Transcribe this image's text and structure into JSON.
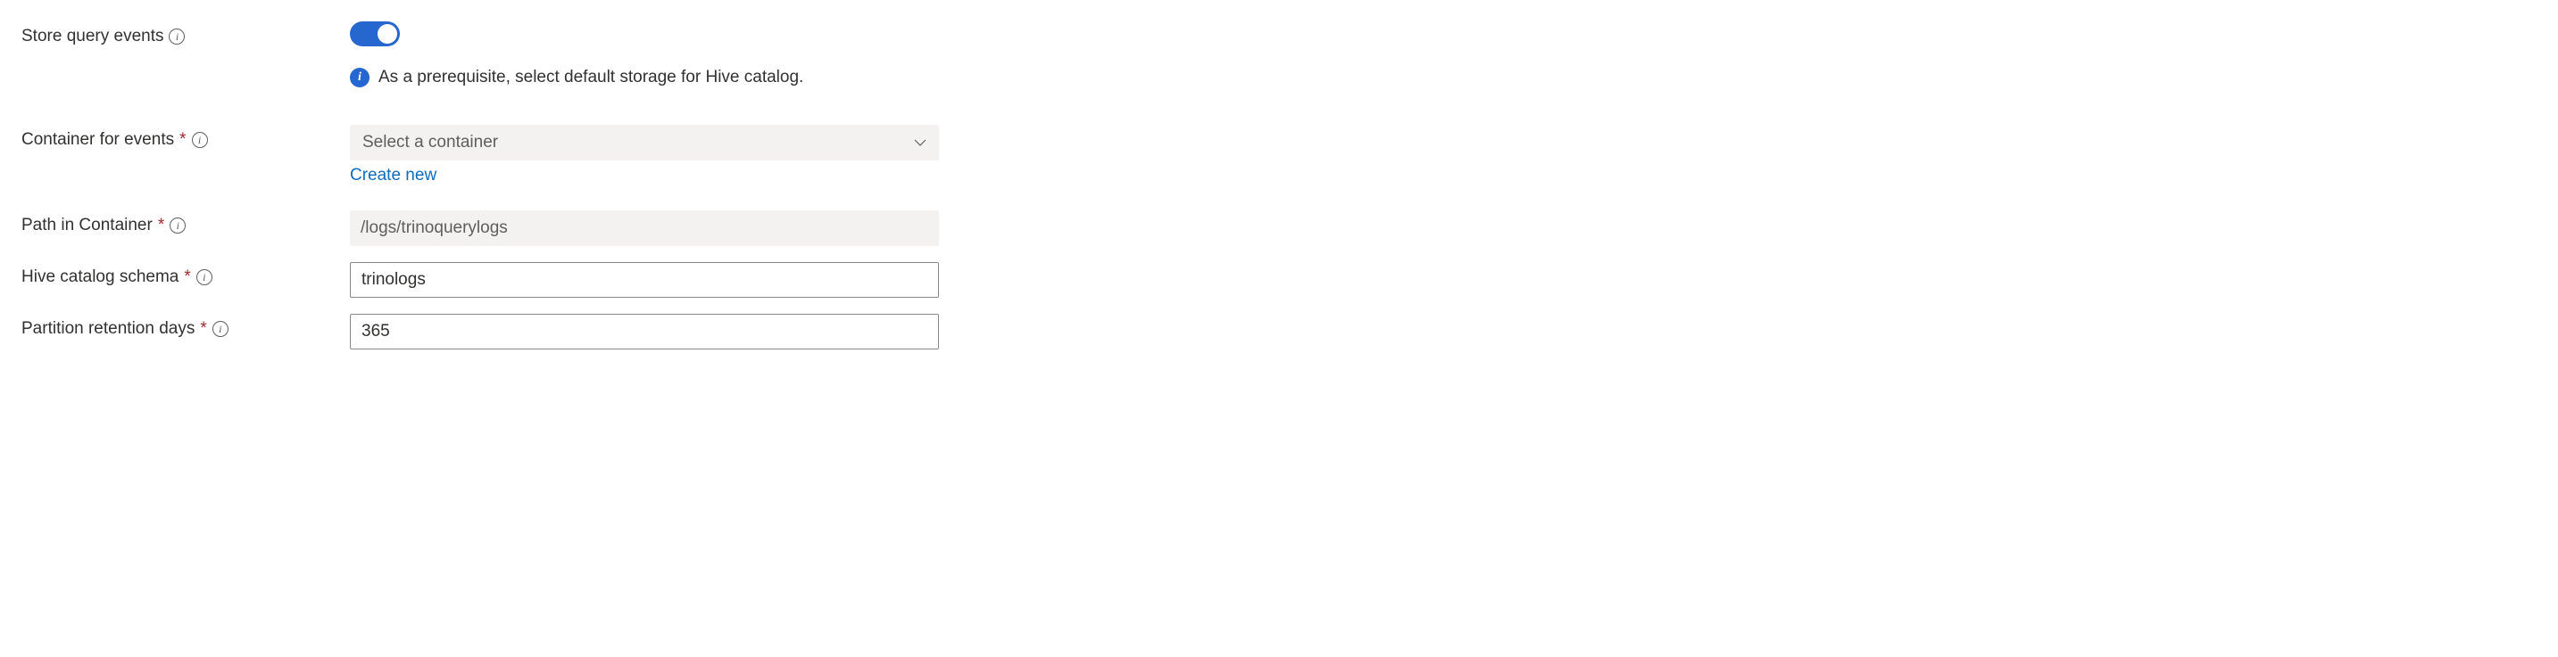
{
  "fields": {
    "store_events": {
      "label": "Store query events",
      "enabled": true,
      "note": "As a prerequisite, select default storage for Hive catalog."
    },
    "container": {
      "label": "Container for events",
      "required": true,
      "placeholder": "Select a container",
      "value": "",
      "create_link": "Create new"
    },
    "path": {
      "label": "Path in Container",
      "required": true,
      "placeholder": "/logs/trinoquerylogs",
      "value": ""
    },
    "schema": {
      "label": "Hive catalog schema",
      "required": true,
      "value": "trinologs"
    },
    "retention": {
      "label": "Partition retention days",
      "required": true,
      "value": "365"
    }
  }
}
